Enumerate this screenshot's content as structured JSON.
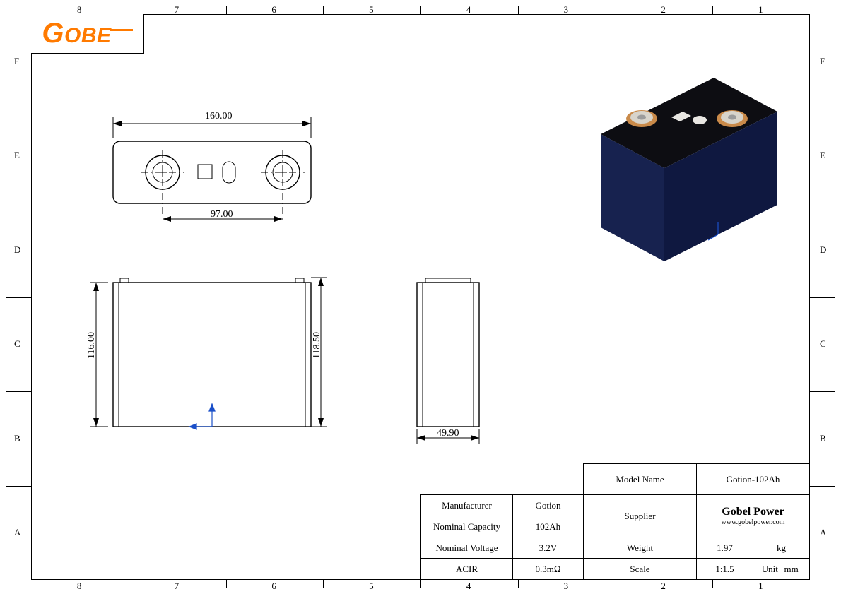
{
  "logo_text": "Gobel",
  "border": {
    "cols": [
      "8",
      "7",
      "6",
      "5",
      "4",
      "3",
      "2",
      "1"
    ],
    "rows": [
      "F",
      "E",
      "D",
      "C",
      "B",
      "A"
    ]
  },
  "dimensions": {
    "top_length": "160.00",
    "terminal_pitch": "97.00",
    "front_height": "116.00",
    "side_height": "118.50",
    "depth": "49.90"
  },
  "title_block": {
    "model_name_label": "Model Name",
    "model_name": "Gotion-102Ah",
    "manufacturer_label": "Manufacturer",
    "manufacturer": "Gotion",
    "supplier_label": "Supplier",
    "supplier_name": "Gobel Power",
    "supplier_url": "www.gobelpower.com",
    "nominal_capacity_label": "Nominal Capacity",
    "nominal_capacity": "102Ah",
    "nominal_voltage_label": "Nominal Voltage",
    "nominal_voltage": "3.2V",
    "weight_label": "Weight",
    "weight_value": "1.97",
    "weight_unit": "kg",
    "acir_label": "ACIR",
    "acir": "0.3mΩ",
    "scale_label": "Scale",
    "scale": "1:1.5",
    "unit_label": "Unit",
    "unit": "mm"
  }
}
